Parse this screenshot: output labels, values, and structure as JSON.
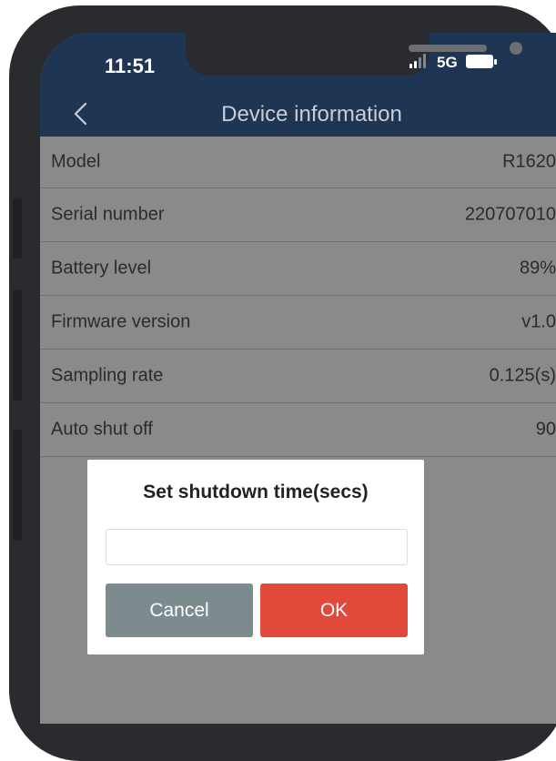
{
  "status_bar": {
    "time": "11:51",
    "network": "5G",
    "signal_icon": "cellular-signal-icon",
    "battery_icon": "battery-icon"
  },
  "header": {
    "title": "Device information",
    "back_icon": "chevron-left-icon"
  },
  "info_rows": [
    {
      "label": "Model",
      "value": "R1620"
    },
    {
      "label": "Serial number",
      "value": "220707010"
    },
    {
      "label": "Battery level",
      "value": "89%"
    },
    {
      "label": "Firmware version",
      "value": "v1.0"
    },
    {
      "label": "Sampling rate",
      "value": "0.125(s)"
    },
    {
      "label": "Auto shut off",
      "value": "90"
    }
  ],
  "dialog": {
    "title": "Set shutdown time(secs)",
    "input_value": "",
    "input_placeholder": "",
    "cancel_label": "Cancel",
    "ok_label": "OK"
  },
  "colors": {
    "header_bg": "#1f3554",
    "overlay_gray": "#8a8a8a",
    "cancel_button": "#7d8b8f",
    "ok_button": "#e14a3a"
  }
}
